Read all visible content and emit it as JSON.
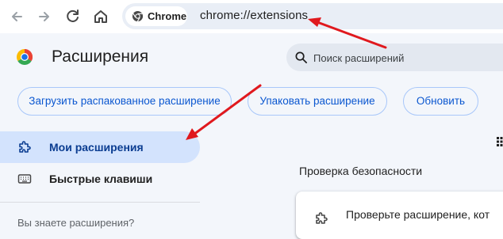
{
  "browser": {
    "chip_label": "Chrome",
    "url": "chrome://extensions",
    "icons": [
      "back-icon",
      "forward-icon",
      "reload-icon",
      "home-icon",
      "chrome-logo-icon"
    ]
  },
  "header": {
    "title": "Расширения",
    "search": {
      "placeholder": "Поиск расширений",
      "value": ""
    }
  },
  "actions": {
    "load_unpacked": "Загрузить распакованное расширение",
    "pack": "Упаковать расширение",
    "update": "Обновить"
  },
  "sidebar": {
    "items": [
      {
        "label": "Мои расширения",
        "icon": "extension-icon",
        "active": true
      },
      {
        "label": "Быстрые клавиши",
        "icon": "keyboard-icon",
        "active": false
      }
    ],
    "more_text": "Вы знаете расширения?"
  },
  "main": {
    "section_title": "Проверка безопасности",
    "card_text": "Проверьте расширение, кот"
  },
  "colors": {
    "accent": "#0b57d0",
    "active_item_bg": "#d3e3fd",
    "annotation_arrow": "#e0191e"
  }
}
